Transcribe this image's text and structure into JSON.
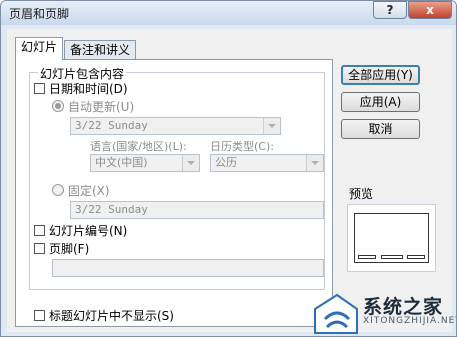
{
  "window": {
    "title": "页眉和页脚",
    "help_button": "?",
    "close_button": "x"
  },
  "tabs": [
    {
      "label": "幻灯片",
      "active": true
    },
    {
      "label": "备注和讲义",
      "active": false
    }
  ],
  "include_group": {
    "legend": "幻灯片包含内容",
    "date_time": {
      "label": "日期和时间(D)",
      "checked": false
    },
    "auto_update": {
      "label": "自动更新(U)",
      "selected": true,
      "disabled": true,
      "date_value": "3/22 Sunday"
    },
    "language": {
      "label": "语言(国家/地区)(L):",
      "value": "中文(中国)"
    },
    "calendar": {
      "label": "日历类型(C):",
      "value": "公历"
    },
    "fixed": {
      "label": "固定(X)",
      "selected": false,
      "disabled": true,
      "value": "3/22 Sunday"
    },
    "slide_number": {
      "label": "幻灯片编号(N)",
      "checked": false
    },
    "footer": {
      "label": "页脚(F)",
      "checked": false,
      "value": ""
    }
  },
  "dont_show_title": {
    "label": "标题幻灯片中不显示(S)",
    "checked": false
  },
  "buttons": {
    "apply_all": "全部应用(Y)",
    "apply": "应用(A)",
    "cancel": "取消"
  },
  "preview": {
    "label": "预览"
  },
  "watermark": {
    "text": "系统之家",
    "url": "XITONGZHIJIA.NET"
  }
}
